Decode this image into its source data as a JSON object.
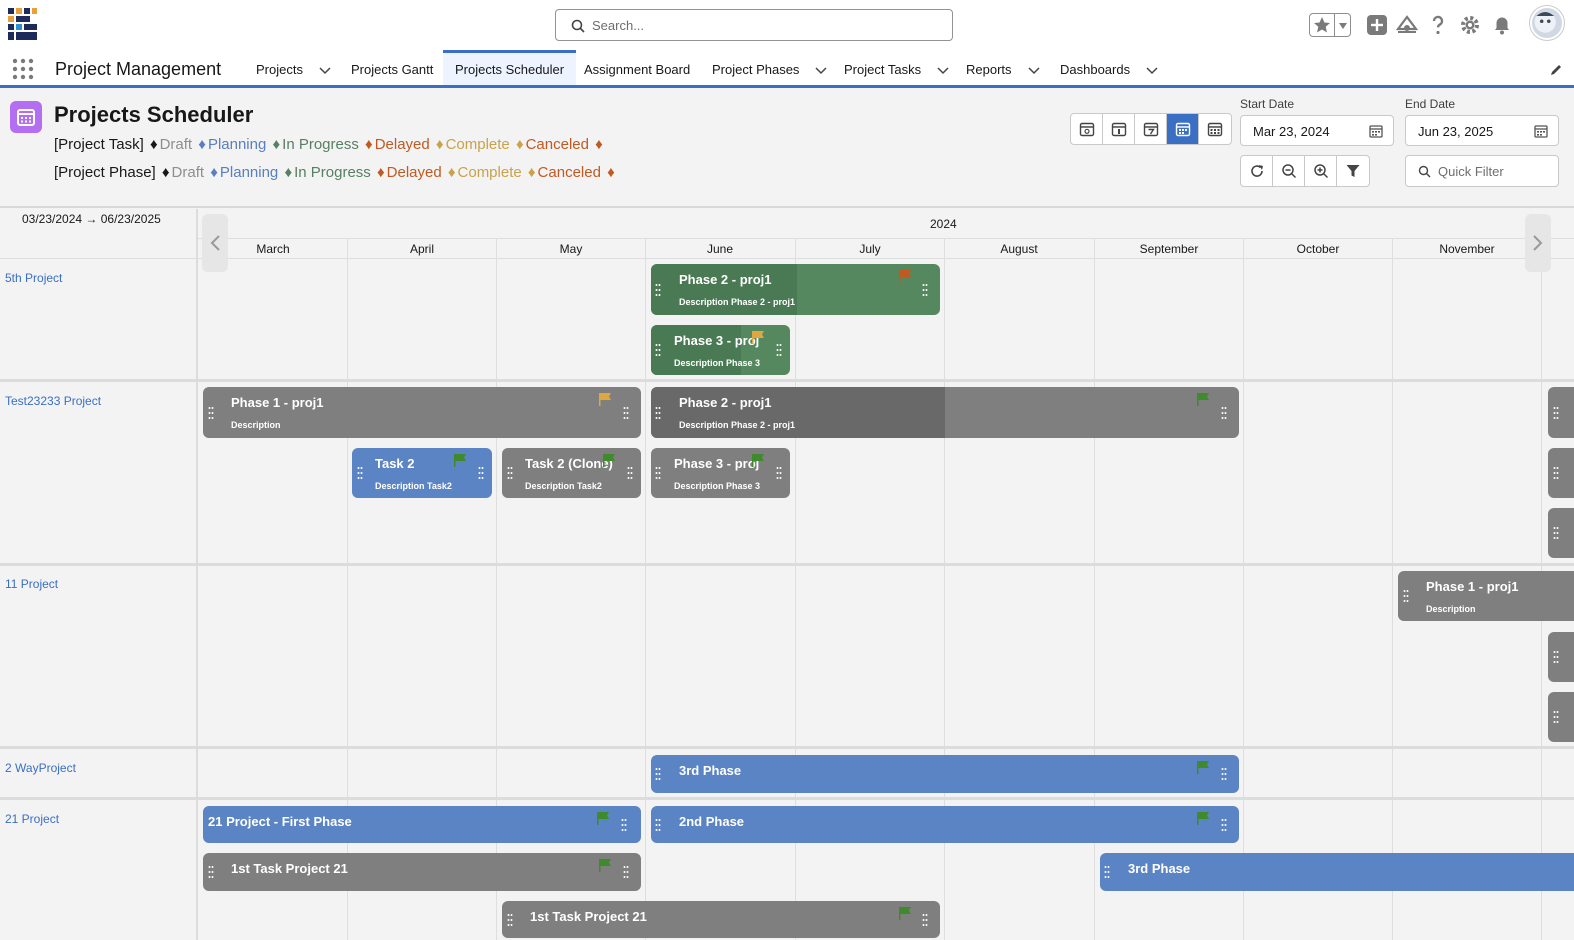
{
  "topbar": {
    "search_placeholder": "Search...",
    "icons": [
      "logo-icon",
      "search-icon",
      "star-icon",
      "chevron-down-icon",
      "add-icon",
      "trailhead-icon",
      "help-icon",
      "gear-icon",
      "bell-icon",
      "avatar"
    ]
  },
  "nav": {
    "app_name": "Project Management",
    "items": [
      {
        "label": "Projects",
        "has_menu": true
      },
      {
        "label": "Projects Gantt",
        "has_menu": false
      },
      {
        "label": "Projects Scheduler",
        "has_menu": false,
        "active": true
      },
      {
        "label": "Assignment Board",
        "has_menu": false
      },
      {
        "label": "Project Phases",
        "has_menu": true
      },
      {
        "label": "Project Tasks",
        "has_menu": true
      },
      {
        "label": "Reports",
        "has_menu": true
      },
      {
        "label": "Dashboards",
        "has_menu": true
      }
    ]
  },
  "header": {
    "title": "Projects Scheduler",
    "legend_task_prefix": "[Project Task]",
    "legend_phase_prefix": "[Project Phase]",
    "statuses": {
      "draft": "Draft",
      "planning": "Planning",
      "in_progress": "In Progress",
      "delayed": "Delayed",
      "complete": "Complete",
      "canceled": "Canceled"
    },
    "diamond": "♦",
    "start_date_label": "Start Date",
    "start_date_value": "Mar 23, 2024",
    "end_date_label": "End Date",
    "end_date_value": "Jun 23, 2025",
    "quick_filter_placeholder": "Quick Filter"
  },
  "colors": {
    "accent": "#3a6fc4",
    "in_progress": "#56885f",
    "draft": "#7f7f7f",
    "planning": "#5b84c4",
    "delayed_flag": "#c05a22",
    "complete_flag": "#e0a640",
    "green_flag": "#3e8a2c"
  },
  "scheduler": {
    "range": "03/23/2024 → 06/23/2025",
    "year": "2024",
    "months": [
      "March",
      "April",
      "May",
      "June",
      "July",
      "August",
      "September",
      "October",
      "November"
    ],
    "rows": [
      {
        "label": "5th Project"
      },
      {
        "label": "Test23233 Project"
      },
      {
        "label": "11 Project"
      },
      {
        "label": "2 WayProject"
      },
      {
        "label": "21 Project"
      }
    ],
    "bars": {
      "r0b0": {
        "title": "Phase 2 - proj1",
        "desc": "Description Phase 2 - proj1"
      },
      "r0b1": {
        "title": "Phase 3 - proj",
        "desc": "Description Phase 3"
      },
      "r1b0": {
        "title": "Phase 1 - proj1",
        "desc": "Description"
      },
      "r1b1": {
        "title": "Phase 2 - proj1",
        "desc": "Description Phase 2 - proj1"
      },
      "r1b2": {
        "title": "Task 2",
        "desc": "Description Task2"
      },
      "r1b3": {
        "title": "Task 2 (Clone)",
        "desc": "Description Task2"
      },
      "r1b4": {
        "title": "Phase 3 - proj",
        "desc": "Description Phase 3"
      },
      "r2b0": {
        "title": "Phase 1 - proj1",
        "desc": "Description"
      },
      "r3b0": {
        "title": "3rd Phase"
      },
      "r4b0": {
        "title": "21 Project - First Phase"
      },
      "r4b1": {
        "title": "2nd Phase"
      },
      "r4b2": {
        "title": "1st Task Project 21"
      },
      "r4b3": {
        "title": "3rd Phase"
      },
      "r4b4": {
        "title": "1st Task Project 21"
      }
    }
  }
}
